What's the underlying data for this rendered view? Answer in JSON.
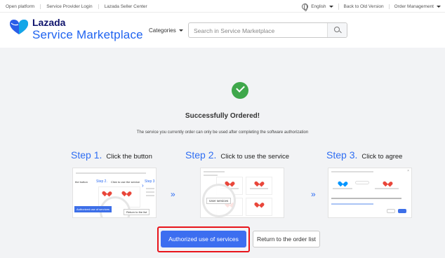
{
  "topbar": {
    "links": [
      "Open platform",
      "Service Provider Login",
      "Lazada Seller Center"
    ],
    "language": "English",
    "back_old": "Back to Old Version",
    "order_management": "Order Management"
  },
  "header": {
    "brand_line1": "Lazada",
    "brand_line2": "Service Marketplace",
    "categories": "Categories",
    "search_placeholder": "Search in Service Marketplace"
  },
  "main": {
    "title": "Successfully Ordered!",
    "subtitle": "The service you currently order can only be used after completing the software authorization",
    "steps": [
      {
        "num": "Step 1.",
        "text": "Click the button"
      },
      {
        "num": "Step 2.",
        "text": "Click to use the service"
      },
      {
        "num": "Step 3.",
        "text": "Click to agree"
      }
    ],
    "thumb1": {
      "label": "the button",
      "step2": "Step 2.",
      "step2_text": "Click to use the service",
      "step3": "Step 3",
      "btn_blue": "Authorized use of services",
      "btn_white": "Return to the list"
    },
    "thumb2": {
      "lens_text": "User services"
    },
    "authorize_button": "Authorized use of services",
    "return_button": "Return to the order list"
  },
  "colors": {
    "accent": "#3c6ef0",
    "success": "#3fa74b",
    "highlight": "#e8141b"
  }
}
